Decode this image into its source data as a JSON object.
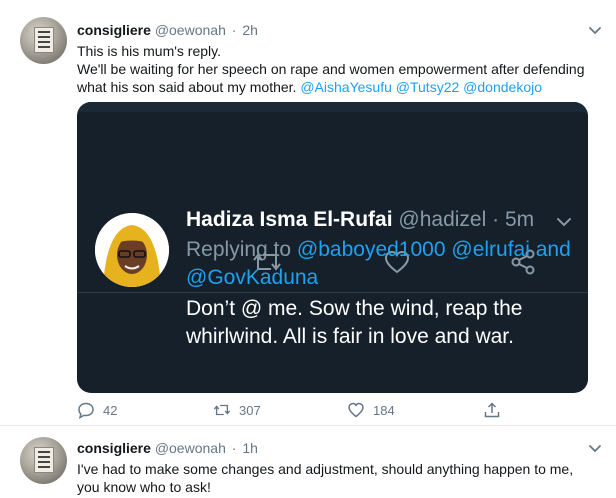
{
  "tweet1": {
    "name": "consigliere",
    "handle": "@oewonah",
    "time": "2h",
    "line1": "This is his mum's reply.",
    "line2_prefix": "We'll be waiting for her speech on rape and women empowerment after defending what his son said about my mother.",
    "mentions": [
      "@AishaYesufu",
      "@Tutsy22",
      "@dondekojo"
    ],
    "embed": {
      "name": "Hadiza Isma El-Rufai",
      "handle": "@hadizel",
      "time": "5m",
      "replying_to": "Replying to",
      "reply_mentions": [
        "@baboyed1000",
        "@elrufai",
        "@GovKaduna"
      ],
      "reply_and": "and",
      "body": "Don’t @ me. Sow the wind, reap the whirlwind. All is fair in love and war."
    },
    "actions": {
      "replies": "42",
      "retweets": "307",
      "likes": "184"
    }
  },
  "tweet2": {
    "name": "consigliere",
    "handle": "@oewonah",
    "time": "1h",
    "text": "I've had to make some changes and adjustment, should anything happen to me, you know who to ask!"
  },
  "dot": "·",
  "colors": {
    "link": "#1da1f2",
    "dark_bg": "#15202b",
    "muted": "#657786"
  }
}
